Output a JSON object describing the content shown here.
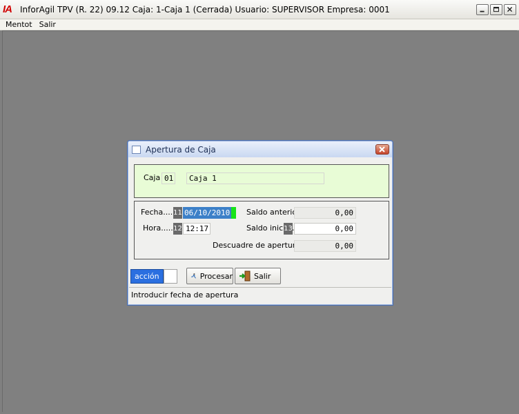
{
  "window": {
    "logo": "IA",
    "title": "InforAgil TPV (R. 22) 09.12 Caja: 1-Caja 1 (Cerrada)  Usuario: SUPERVISOR  Empresa: 0001"
  },
  "menu": [
    "Mentot",
    "Salir"
  ],
  "dialog": {
    "title": "Apertura de Caja",
    "caja_label": "Caja",
    "caja_code": "01",
    "caja_name": "Caja 1",
    "fecha_label": "Fecha......",
    "fecha_index": "11",
    "fecha_value": "06/10/2010",
    "hora_label": "Hora.........",
    "hora_index": "12",
    "hora_value": "12:17",
    "saldo_anterior_label": "Saldo anterior",
    "saldo_anterior_value": "0,00",
    "saldo_inicial_label": "Saldo inicial.",
    "saldo_inicial_index": "13",
    "saldo_inicial_value": "0,00",
    "descuadre_label": "Descuadre de apertura",
    "descuadre_value": "0,00",
    "accion_label": "acción",
    "procesar_label": "Procesar",
    "salir_label": "Salir",
    "status_text": "Introducir fecha de apertura"
  },
  "colors": {
    "accent_panel": "#e8fcd6",
    "date_highlight": "#18e418",
    "selection": "#3c80c8",
    "accion_bg": "#2b6fe0"
  }
}
